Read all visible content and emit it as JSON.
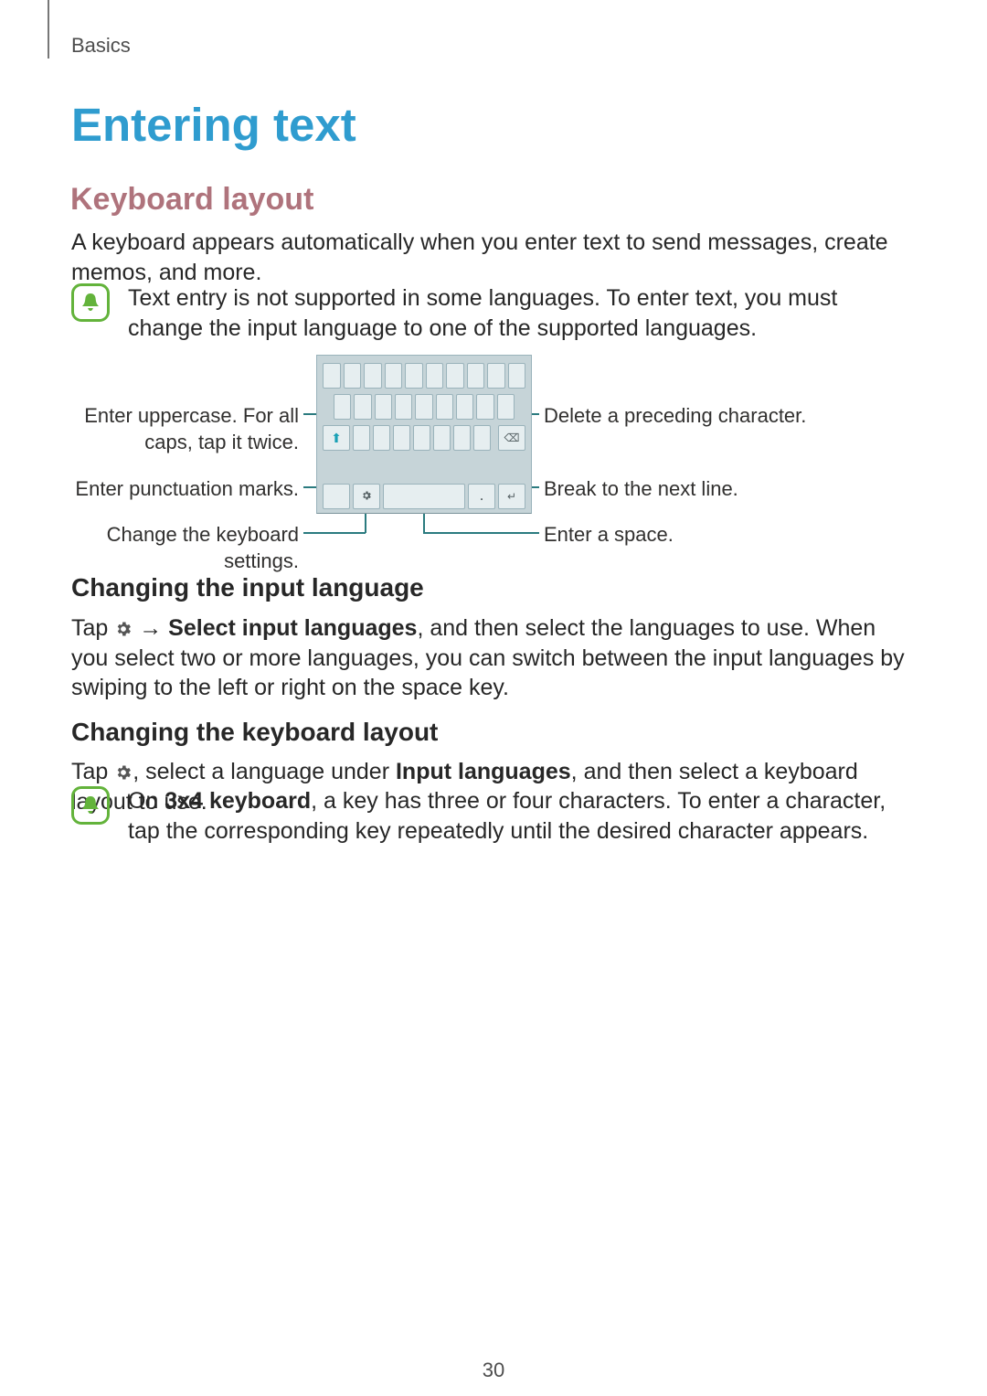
{
  "breadcrumb": "Basics",
  "pageTitle": "Entering text",
  "section1Title": "Keyboard layout",
  "section1Body": "A keyboard appears automatically when you enter text to send messages, create memos, and more.",
  "note1": "Text entry is not supported in some languages. To enter text, you must change the input language to one of the supported languages.",
  "callouts": {
    "uppercase": "Enter uppercase. For all caps, tap it twice.",
    "punctuation": "Enter punctuation marks.",
    "settings": "Change the keyboard settings.",
    "delete": "Delete a preceding character.",
    "nextline": "Break to the next line.",
    "space": "Enter a space."
  },
  "sub1Title": "Changing the input language",
  "sub1": {
    "pre": "Tap ",
    "arrow": " → ",
    "bold1": "Select input languages",
    "post": ", and then select the languages to use. When you select two or more languages, you can switch between the input languages by swiping to the left or right on the space key."
  },
  "sub2Title": "Changing the keyboard layout",
  "sub2": {
    "pre": "Tap ",
    "mid": ", select a language under ",
    "bold1": "Input languages",
    "post": ", and then select a keyboard layout to use."
  },
  "note2": {
    "pre": "On ",
    "bold1": "3x4 keyboard",
    "post": ", a key has three or four characters. To enter a character, tap the corresponding key repeatedly until the desired character appears."
  },
  "pageNumber": "30"
}
